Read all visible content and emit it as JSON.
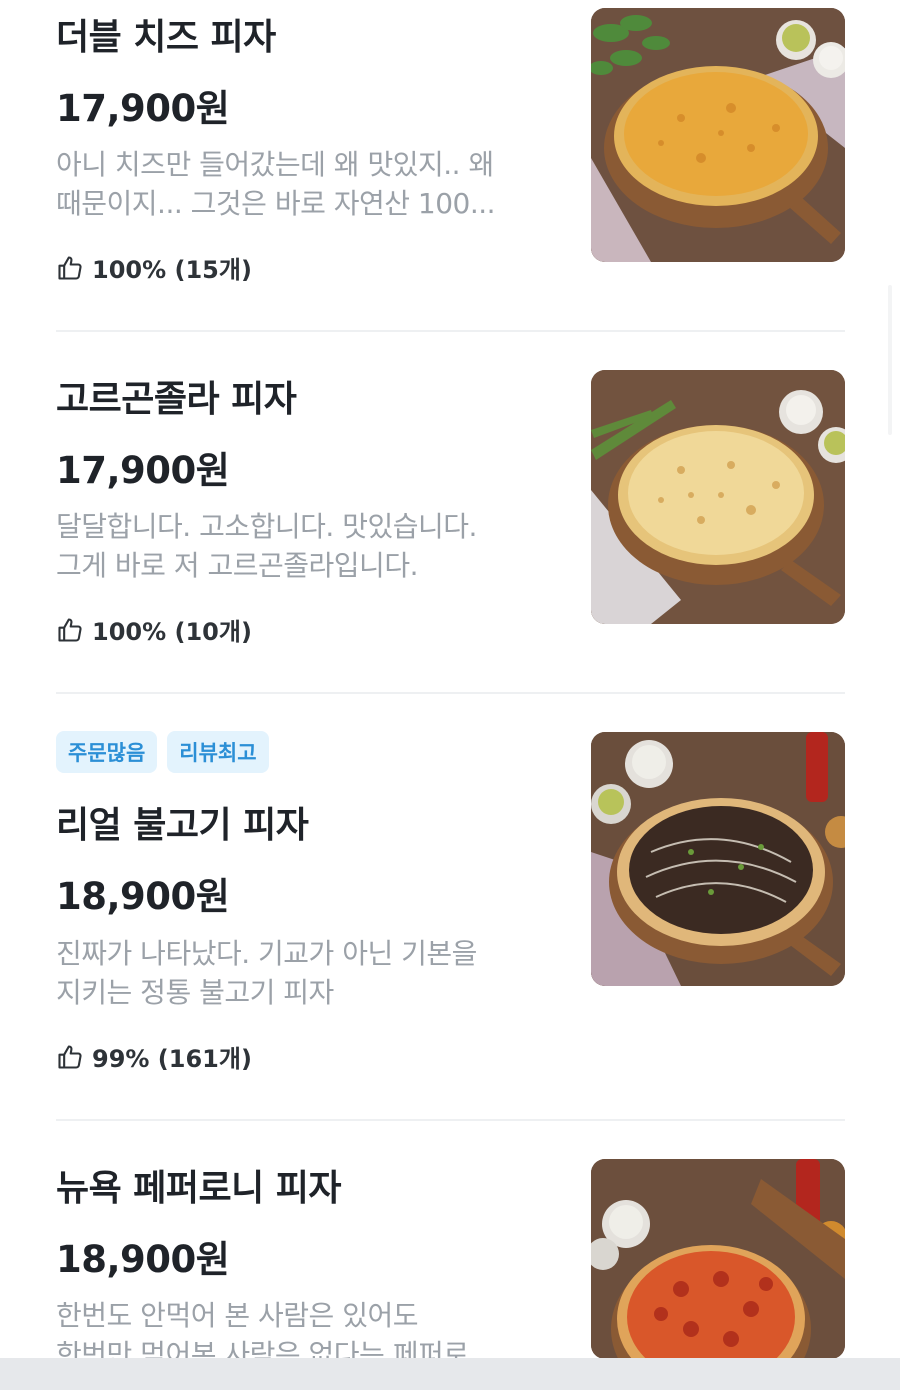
{
  "items": [
    {
      "name": "더블 치즈 피자",
      "price": "17,900원",
      "desc_line1": "아니 치즈만 들어갔는데 왜 맛있지.. 왜",
      "desc_line2": "때문이지... 그것은 바로 자연산 100...",
      "rating": "100% (15개)"
    },
    {
      "name": "고르곤졸라 피자",
      "price": "17,900원",
      "desc_line1": "달달합니다. 고소합니다. 맛있습니다.",
      "desc_line2": "그게 바로 저 고르곤졸라입니다.",
      "rating": "100% (10개)"
    },
    {
      "badges": [
        "주문많음",
        "리뷰최고"
      ],
      "name": "리얼 불고기 피자",
      "price": "18,900원",
      "desc_line1": "진짜가 나타났다. 기교가 아닌 기본을",
      "desc_line2": "지키는 정통 불고기 피자",
      "rating": "99% (161개)"
    },
    {
      "name": "뉴욕 페퍼로니 피자",
      "price": "18,900원",
      "desc_line1": "한번도 안먹어 본 사람은 있어도",
      "desc_line2": "한번만 먹어본 사람은 없다는 페퍼로",
      "rating": ""
    }
  ],
  "icons": {
    "rating": "thumbs-up-icon"
  },
  "colors": {
    "badge_bg": "#e3f3fd",
    "badge_text": "#2b8fd6",
    "desc": "#9ba1a8",
    "wood": "#6b4f3c"
  }
}
